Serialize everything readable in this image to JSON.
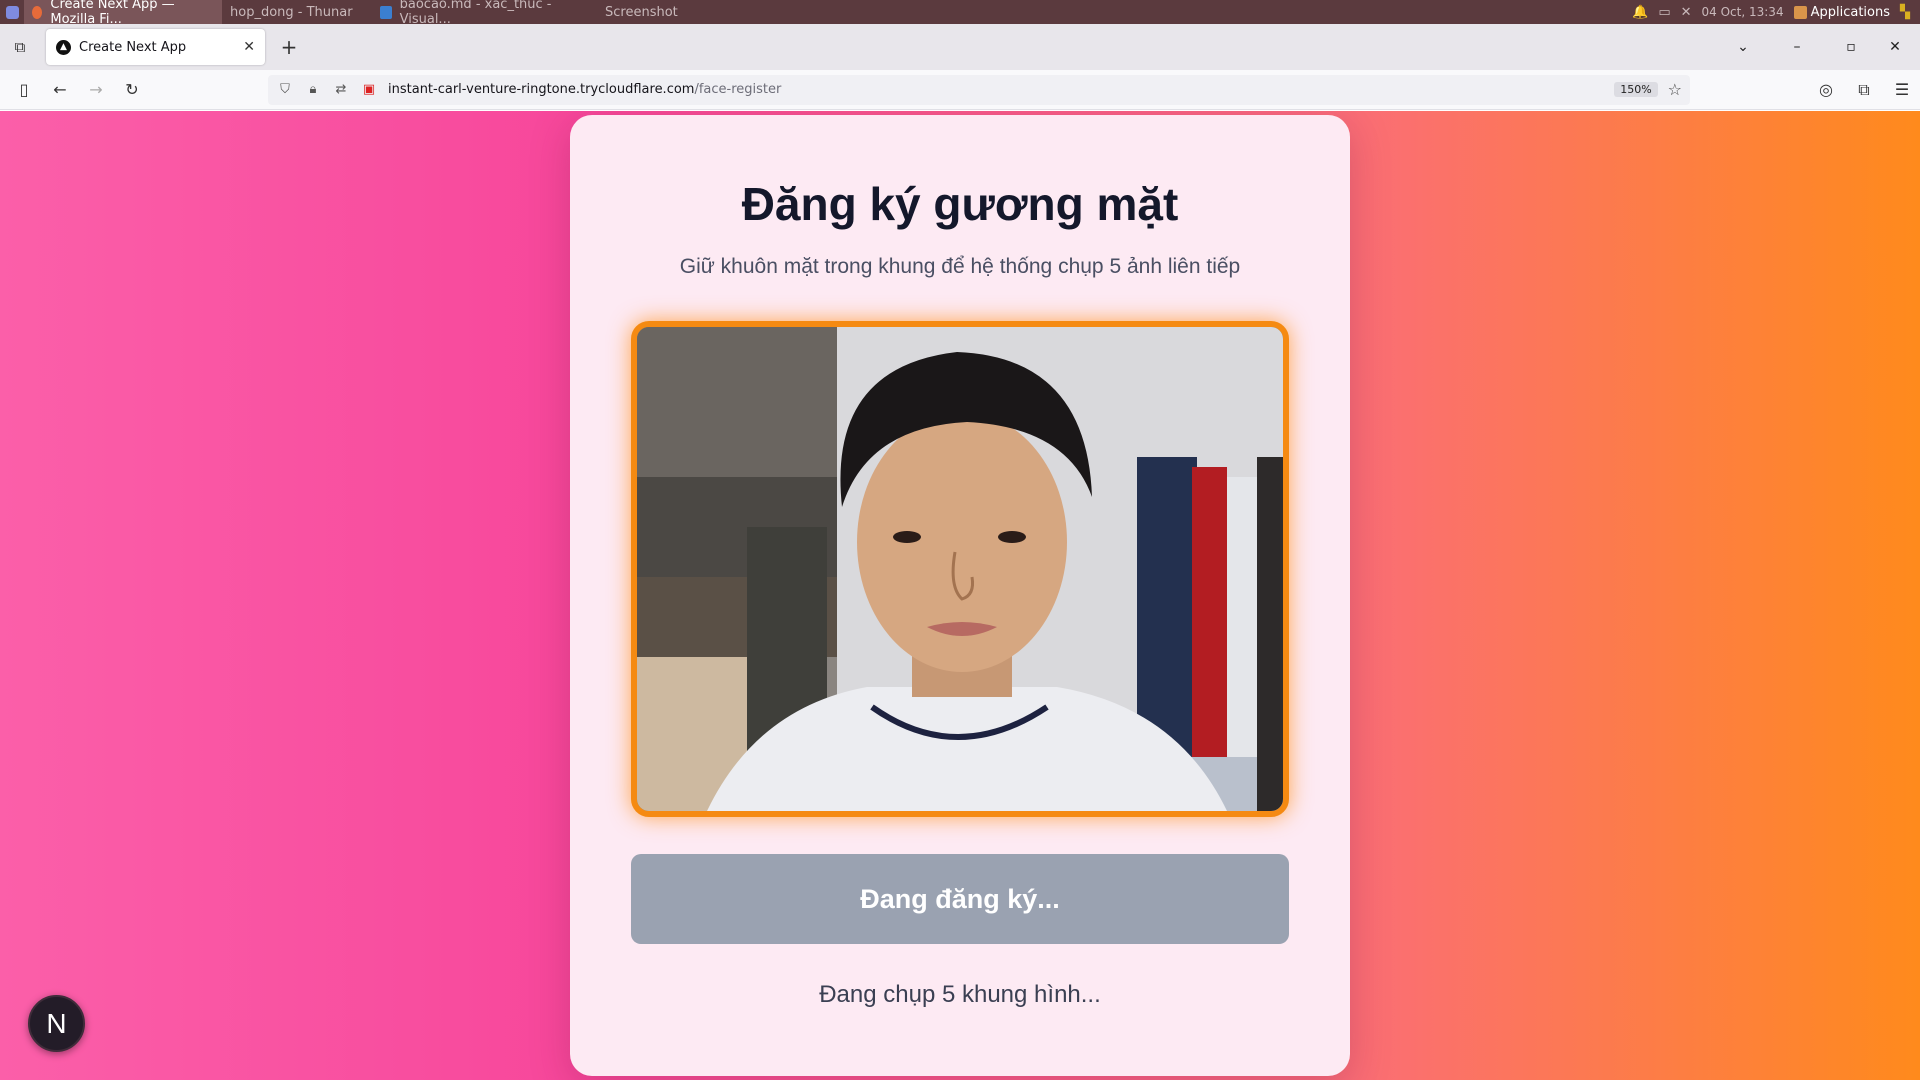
{
  "os_panel": {
    "tasks": [
      {
        "label": "Create Next App — Mozilla Fi...",
        "active": true
      },
      {
        "label": "hop_dong - Thunar",
        "active": false
      },
      {
        "label": "baocao.md - xac_thuc - Visual...",
        "active": false
      },
      {
        "label": "Screenshot",
        "active": false
      }
    ],
    "clock": "04 Oct, 13:34",
    "applications_label": "Applications"
  },
  "browser": {
    "tab_title": "Create Next App",
    "new_tab_symbol": "+",
    "url_host": "instant-carl-venture-ringtone.trycloudflare.com",
    "url_path": "/face-register",
    "zoom": "150%"
  },
  "page": {
    "title": "Đăng ký gương mặt",
    "subtitle": "Giữ khuôn mặt trong khung để hệ thống chụp 5 ảnh liên tiếp",
    "button_label": "Đang đăng ký...",
    "status_text": "Đang chụp 5 khung hình...",
    "next_badge": "N"
  },
  "colors": {
    "gradient_left": "#fb5fa9",
    "gradient_right": "#ff8a1c",
    "camera_border": "#f58a12",
    "button_disabled": "#9aa2b1",
    "title_color": "#14182b"
  }
}
